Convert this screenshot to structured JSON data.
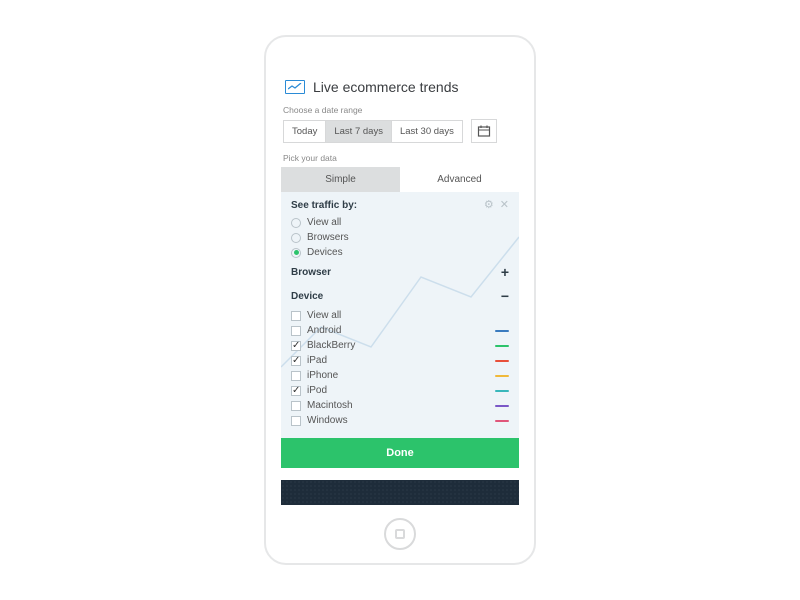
{
  "header": {
    "title": "Live ecommerce trends"
  },
  "date": {
    "label": "Choose a date range",
    "options": [
      "Today",
      "Last 7 days",
      "Last 30 days"
    ],
    "active": 1
  },
  "pick_label": "Pick your data",
  "tabs": {
    "simple": "Simple",
    "advanced": "Advanced",
    "active": 0
  },
  "filter": {
    "title": "See traffic by:",
    "radios": [
      {
        "label": "View all",
        "on": false
      },
      {
        "label": "Browsers",
        "on": false
      },
      {
        "label": "Devices",
        "on": true
      }
    ],
    "browser_group": "Browser",
    "device_group": "Device",
    "devices": [
      {
        "label": "View all",
        "on": false,
        "color": null
      },
      {
        "label": "Android",
        "on": false,
        "color": "#3a7bbf"
      },
      {
        "label": "BlackBerry",
        "on": true,
        "color": "#2cc36b"
      },
      {
        "label": "iPad",
        "on": true,
        "color": "#e8503a"
      },
      {
        "label": "iPhone",
        "on": false,
        "color": "#f0b93a"
      },
      {
        "label": "iPod",
        "on": true,
        "color": "#39b7bb"
      },
      {
        "label": "Macintosh",
        "on": false,
        "color": "#7a57c7"
      },
      {
        "label": "Windows",
        "on": false,
        "color": "#e0567a"
      }
    ]
  },
  "done": "Done"
}
